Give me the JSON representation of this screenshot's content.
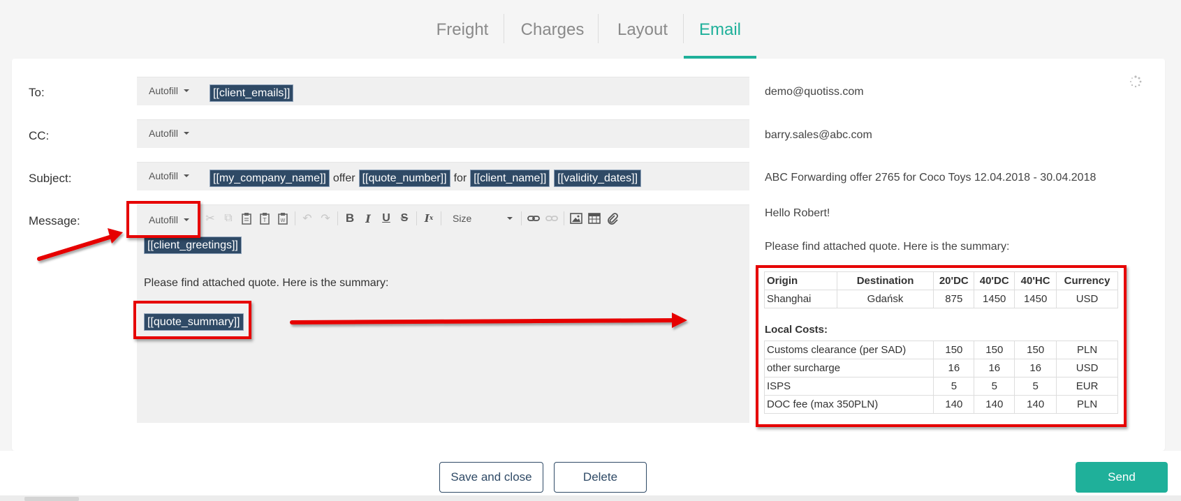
{
  "tabs": [
    {
      "label": "Freight",
      "active": false
    },
    {
      "label": "Charges",
      "active": false
    },
    {
      "label": "Layout",
      "active": false
    },
    {
      "label": "Email",
      "active": true
    }
  ],
  "form": {
    "autofill_label": "Autofill",
    "to": {
      "label": "To:",
      "tags": [
        "[[client_emails]]"
      ],
      "preview": "demo@quotiss.com"
    },
    "cc": {
      "label": "CC:",
      "preview": "barry.sales@abc.com"
    },
    "subject": {
      "label": "Subject:",
      "parts": [
        "[[my_company_name]]",
        "offer",
        "[[quote_number]]",
        "for",
        "[[client_name]]",
        "[[validity_dates]]"
      ],
      "preview": "ABC Forwarding offer 2765 for Coco Toys 12.04.2018 - 30.04.2018"
    },
    "message": {
      "label": "Message:",
      "size_label": "Size",
      "greeting_tag": "[[client_greetings]]",
      "body_text": "Please find attached quote. Here is the summary:",
      "summary_tag": "[[quote_summary]]"
    }
  },
  "preview": {
    "greeting": "Hello Robert!",
    "body_text": "Please find attached quote. Here is the summary:",
    "freight_table": {
      "headers": [
        "Origin",
        "Destination",
        "20'DC",
        "40'DC",
        "40'HC",
        "Currency"
      ],
      "rows": [
        [
          "Shanghai",
          "Gdańsk",
          "875",
          "1450",
          "1450",
          "USD"
        ]
      ]
    },
    "local_costs_title": "Local Costs:",
    "local_costs": [
      [
        "Customs clearance (per SAD)",
        "150",
        "150",
        "150",
        "PLN"
      ],
      [
        "other surcharge",
        "16",
        "16",
        "16",
        "USD"
      ],
      [
        "ISPS",
        "5",
        "5",
        "5",
        "EUR"
      ],
      [
        "DOC fee (max 350PLN)",
        "140",
        "140",
        "140",
        "PLN"
      ]
    ]
  },
  "footer": {
    "save_close": "Save and close",
    "delete": "Delete",
    "send": "Send"
  },
  "colors": {
    "accent": "#1fb09a",
    "tag_bg": "#2f4a66",
    "highlight": "#e60000"
  }
}
